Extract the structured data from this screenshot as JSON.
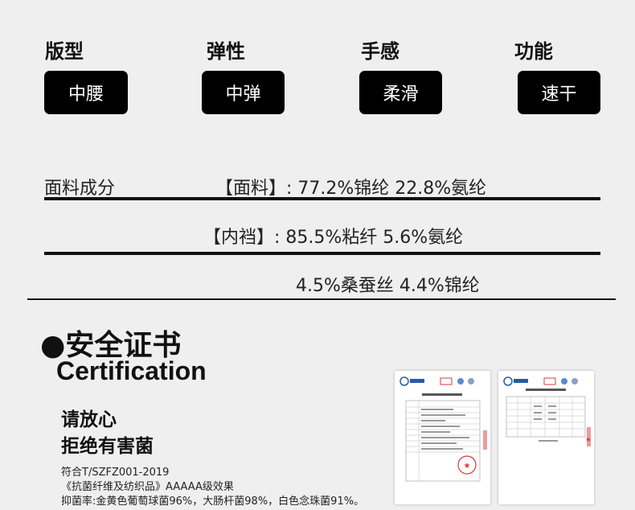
{
  "attributes": [
    {
      "label": "版型",
      "value": "中腰"
    },
    {
      "label": "弹性",
      "value": "中弹"
    },
    {
      "label": "手感",
      "value": "柔滑"
    },
    {
      "label": "功能",
      "value": "速干"
    }
  ],
  "fabric": {
    "heading": "面料成分",
    "row1": "【面料】: 77.2%锦纶  22.8%氨纶",
    "row2": "【内裆】:  85.5%粘纤  5.6%氨纶",
    "row3": "4.5%桑蚕丝  4.4%锦纶"
  },
  "certification": {
    "title": "●安全证书",
    "subtitle": "Certification",
    "slogan1": "请放心",
    "slogan2": "拒绝有害菌",
    "standard": "符合T/SZFZ001-2019",
    "standard_name": "《抗菌纤维及纺织品》AAAAA级效果",
    "rates": "抑菌率:金黄色葡萄球菌96%，大肠杆菌98%，白色念珠菌91%。",
    "doc_logo": "中广测",
    "doc_mark": "MA"
  },
  "colors": {
    "pill_bg": "#000000",
    "background": "#efefef",
    "stamp": "#d83a3a"
  }
}
